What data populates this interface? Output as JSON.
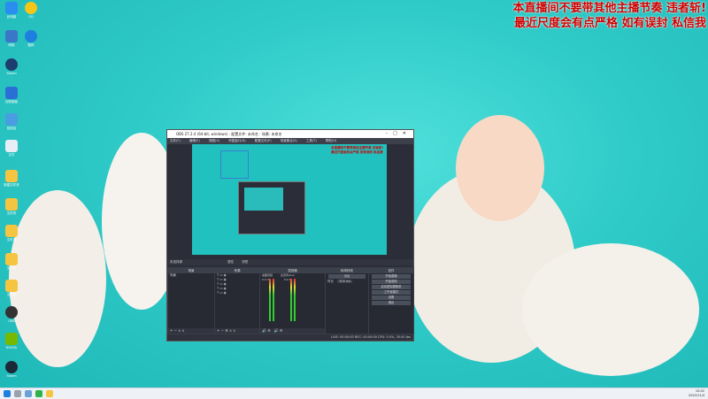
{
  "overlay": {
    "line1": "本直播间不要带其他主播节奏 违者斩!",
    "line2": "最近尺度会有点严格 如有误封 私信我"
  },
  "obs": {
    "title": "OBS 27.2.4 (64-bit, windows) - 配置文件: 未命名 - 场景: 未命名",
    "menu": [
      "文件(F)",
      "编辑(E)",
      "视图(V)",
      "停靠窗口(D)",
      "配置文件(P)",
      "场景集合(S)",
      "工具(T)",
      "帮助(H)"
    ],
    "source_bar": "未选择源",
    "source_buttons": [
      "属性",
      "滤镜"
    ],
    "docks": {
      "scenes": {
        "title": "场景",
        "items": [
          "场景"
        ]
      },
      "sources": {
        "title": "来源"
      },
      "mixer": {
        "title": "混音器",
        "channels": [
          "桌面音频",
          "麦克风/Aux"
        ],
        "levels": [
          "0.0 dB",
          "0.0 dB"
        ]
      },
      "transitions": {
        "title": "转场特效",
        "type": "淡出",
        "duration_label": "时长",
        "duration": "300 ms"
      },
      "controls": {
        "title": "控件",
        "buttons": [
          "开始直播",
          "开始录制",
          "启动虚拟摄像机",
          "工作室模式",
          "设置",
          "退出"
        ]
      }
    },
    "status": "LIVE: 00:00:00   REC: 00:00:00   CPU: 5.0%, 30.00 fps"
  },
  "taskbar": {
    "time": "10:02",
    "date": "2022/11/4"
  },
  "colors": {
    "wallpaper": "#2fcbc8",
    "overlay_text": "#cc0000",
    "obs_bg": "#2b2e38"
  }
}
